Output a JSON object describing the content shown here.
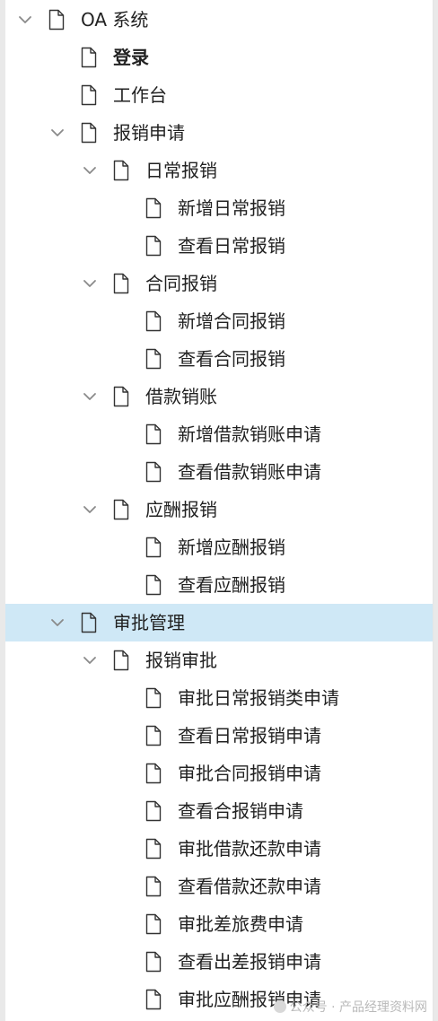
{
  "tree": [
    {
      "label": "OA 系统",
      "level": 0,
      "expanded": true,
      "bold": false,
      "selected": false
    },
    {
      "label": "登录",
      "level": 1,
      "expanded": null,
      "bold": true,
      "selected": false
    },
    {
      "label": "工作台",
      "level": 1,
      "expanded": null,
      "bold": false,
      "selected": false
    },
    {
      "label": "报销申请",
      "level": 1,
      "expanded": true,
      "bold": false,
      "selected": false
    },
    {
      "label": "日常报销",
      "level": 2,
      "expanded": true,
      "bold": false,
      "selected": false
    },
    {
      "label": "新增日常报销",
      "level": 3,
      "expanded": null,
      "bold": false,
      "selected": false
    },
    {
      "label": "查看日常报销",
      "level": 3,
      "expanded": null,
      "bold": false,
      "selected": false
    },
    {
      "label": "合同报销",
      "level": 2,
      "expanded": true,
      "bold": false,
      "selected": false
    },
    {
      "label": "新增合同报销",
      "level": 3,
      "expanded": null,
      "bold": false,
      "selected": false
    },
    {
      "label": "查看合同报销",
      "level": 3,
      "expanded": null,
      "bold": false,
      "selected": false
    },
    {
      "label": "借款销账",
      "level": 2,
      "expanded": true,
      "bold": false,
      "selected": false
    },
    {
      "label": "新增借款销账申请",
      "level": 3,
      "expanded": null,
      "bold": false,
      "selected": false
    },
    {
      "label": "查看借款销账申请",
      "level": 3,
      "expanded": null,
      "bold": false,
      "selected": false
    },
    {
      "label": "应酬报销",
      "level": 2,
      "expanded": true,
      "bold": false,
      "selected": false
    },
    {
      "label": "新增应酬报销",
      "level": 3,
      "expanded": null,
      "bold": false,
      "selected": false
    },
    {
      "label": "查看应酬报销",
      "level": 3,
      "expanded": null,
      "bold": false,
      "selected": false
    },
    {
      "label": "审批管理",
      "level": 1,
      "expanded": true,
      "bold": false,
      "selected": true
    },
    {
      "label": "报销审批",
      "level": 2,
      "expanded": true,
      "bold": false,
      "selected": false
    },
    {
      "label": "审批日常报销类申请",
      "level": 3,
      "expanded": null,
      "bold": false,
      "selected": false
    },
    {
      "label": "查看日常报销申请",
      "level": 3,
      "expanded": null,
      "bold": false,
      "selected": false
    },
    {
      "label": "审批合同报销申请",
      "level": 3,
      "expanded": null,
      "bold": false,
      "selected": false
    },
    {
      "label": "查看合报销申请",
      "level": 3,
      "expanded": null,
      "bold": false,
      "selected": false
    },
    {
      "label": "审批借款还款申请",
      "level": 3,
      "expanded": null,
      "bold": false,
      "selected": false
    },
    {
      "label": "查看借款还款申请",
      "level": 3,
      "expanded": null,
      "bold": false,
      "selected": false
    },
    {
      "label": "审批差旅费申请",
      "level": 3,
      "expanded": null,
      "bold": false,
      "selected": false
    },
    {
      "label": "查看出差报销申请",
      "level": 3,
      "expanded": null,
      "bold": false,
      "selected": false
    },
    {
      "label": "审批应酬报销申请",
      "level": 3,
      "expanded": null,
      "bold": false,
      "selected": false
    }
  ],
  "watermark": "公众号 · 产品经理资料网",
  "colors": {
    "selected_bg": "#cfe8f6",
    "icon_stroke": "#333333",
    "chevron": "#8a8a8a"
  }
}
